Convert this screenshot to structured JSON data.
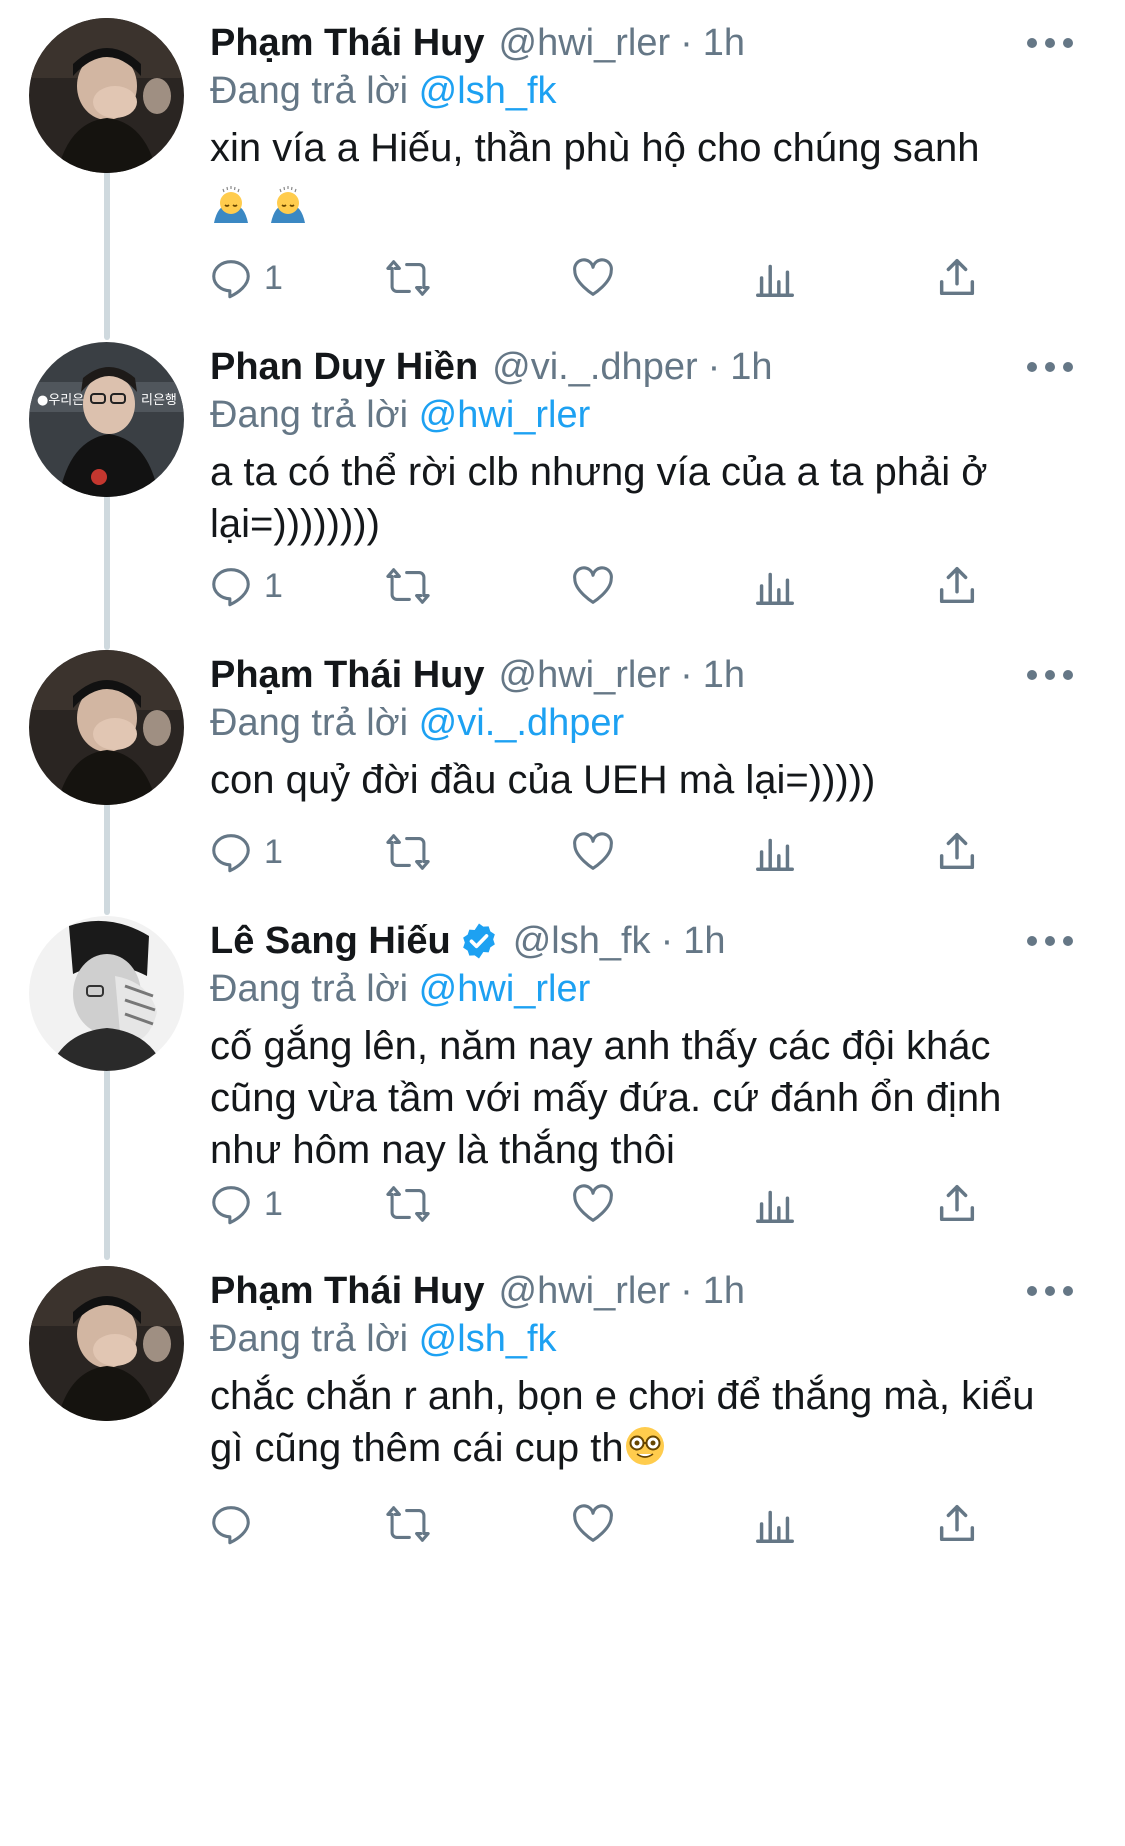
{
  "colors": {
    "text": "#14171a",
    "muted": "#657786",
    "accent": "#1da1f2",
    "thread_line": "#cfd9de"
  },
  "labels": {
    "replying_prefix": "Đang trả lời"
  },
  "tweets": [
    {
      "name": "Phạm Thái Huy",
      "handle": "@hwi_rler",
      "time": "1h",
      "reply_to": "@lsh_fk",
      "text": "xin vía a Hiếu, thần phù hộ cho chúng sanh",
      "emoji": [
        "bowing-emoji",
        "bowing-emoji"
      ],
      "reply_count": "1",
      "verified": false,
      "avatar": "avatar-huy"
    },
    {
      "name": "Phan Duy Hiền",
      "handle": "@vi._.dhper",
      "time": "1h",
      "reply_to": "@hwi_rler",
      "text": "a ta có thể rời clb nhưng vía của a ta phải ở lại=))))))))",
      "reply_count": "1",
      "verified": false,
      "avatar": "avatar-hien"
    },
    {
      "name": "Phạm Thái Huy",
      "handle": "@hwi_rler",
      "time": "1h",
      "reply_to": "@vi._.dhper",
      "text": "con quỷ đời đầu của UEH mà lại=)))))",
      "reply_count": "1",
      "verified": false,
      "avatar": "avatar-huy"
    },
    {
      "name": "Lê Sang Hiếu",
      "handle": "@lsh_fk",
      "time": "1h",
      "reply_to": "@hwi_rler",
      "text": "cố gắng lên, năm nay anh thấy các đội khác cũng vừa tầm với mấy đứa. cứ đánh ổn định như hôm nay là thắng thôi",
      "reply_count": "1",
      "verified": true,
      "avatar": "avatar-hieu"
    },
    {
      "name": "Phạm Thái Huy",
      "handle": "@hwi_rler",
      "time": "1h",
      "reply_to": "@lsh_fk",
      "text": "chắc chắn r anh, bọn e chơi để thắng mà, kiểu gì cũng thêm cái cup th",
      "emoji": [
        "nerd-face-emoji"
      ],
      "reply_count": "",
      "verified": false,
      "avatar": "avatar-huy"
    }
  ]
}
